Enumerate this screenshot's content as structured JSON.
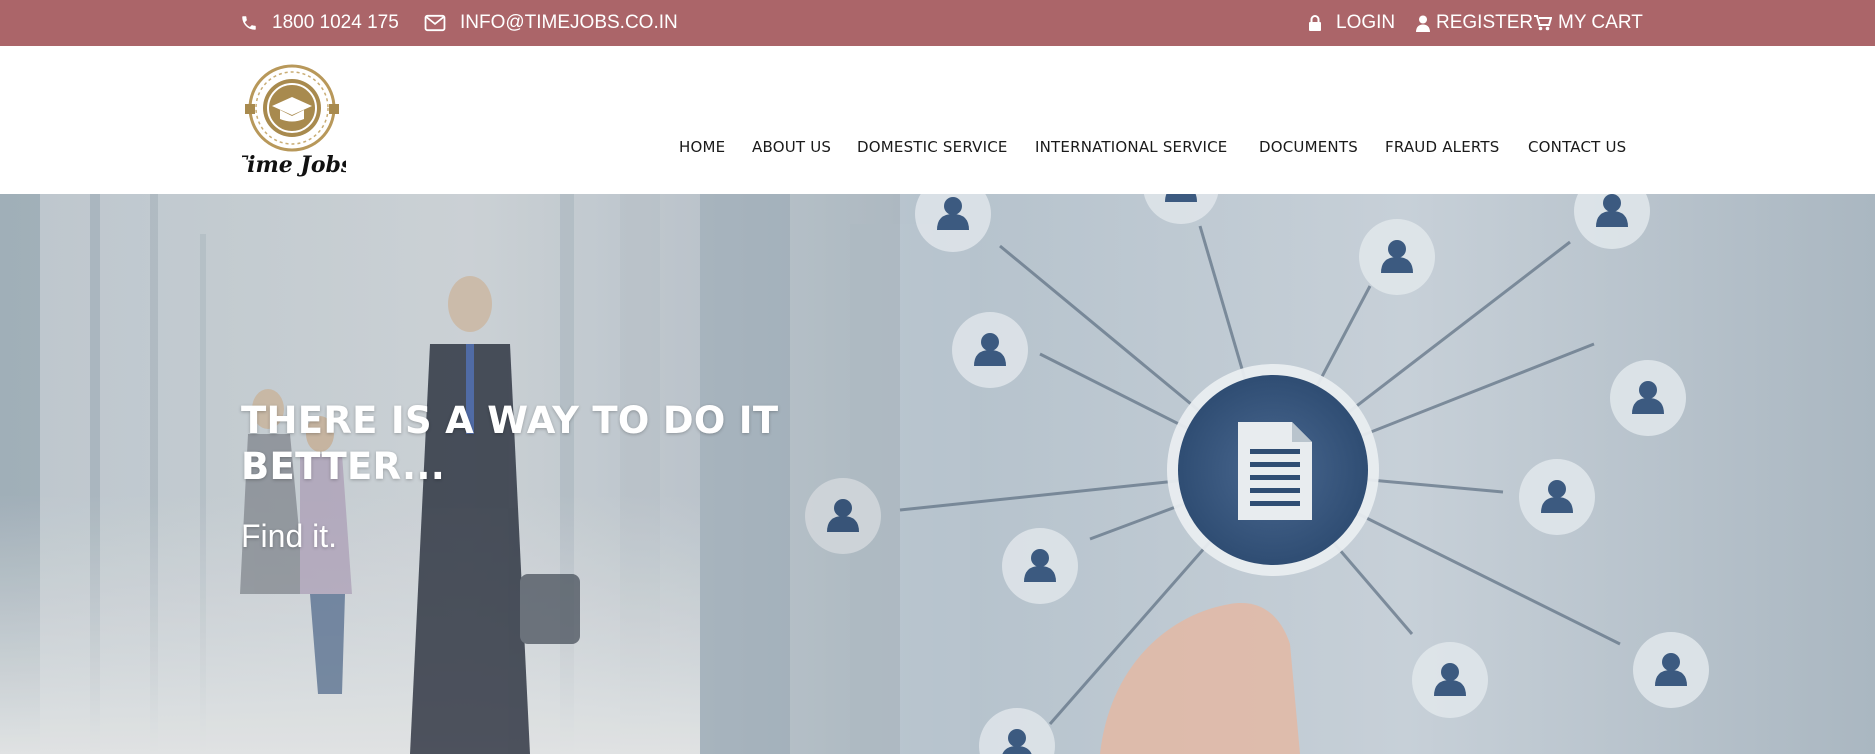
{
  "topbar": {
    "phone": "1800 1024 175",
    "email": "INFO@TIMEJOBS.CO.IN",
    "login": "LOGIN",
    "register": "REGISTER",
    "cart": "MY CART",
    "bg_color": "#ab6569"
  },
  "logo": {
    "text": "Time Jobs",
    "ring_color": "#b8985a",
    "inner_color": "#a88a4e"
  },
  "nav": {
    "items": [
      "HOME",
      "ABOUT US",
      "DOMESTIC SERVICE",
      "INTERNATIONAL SERVICE",
      "DOCUMENTS",
      "FRAUD ALERTS",
      "CONTACT US"
    ]
  },
  "hero": {
    "title": "THERE IS A WAY TO DO IT BETTER...",
    "subtitle": "Find it.",
    "accent_color": "#3f5f84"
  }
}
